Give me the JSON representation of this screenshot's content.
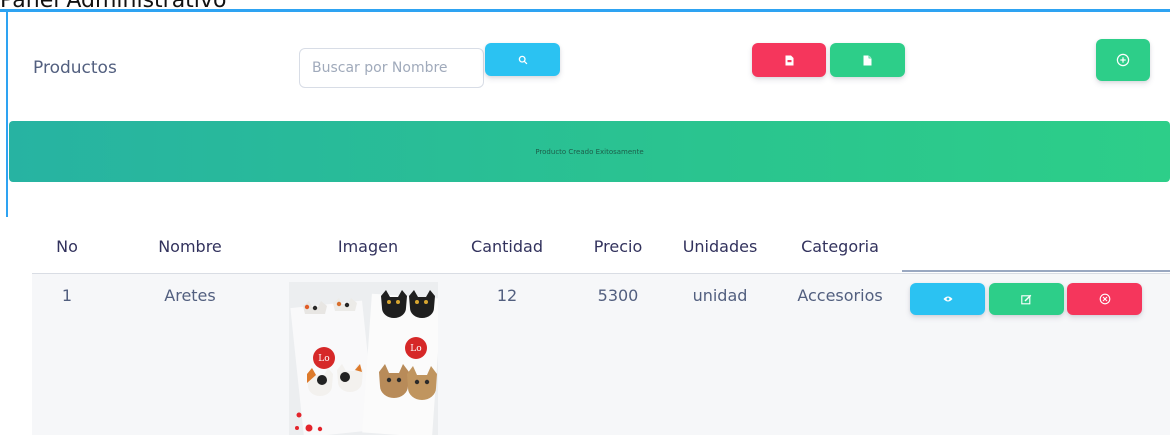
{
  "page": {
    "heading": "Panel Administrativo"
  },
  "header": {
    "section_title": "Productos",
    "search": {
      "placeholder": "Buscar por Nombre",
      "value": ""
    },
    "icons": {
      "search": "search-icon",
      "pdf": "pdf-file-icon",
      "excel": "excel-file-icon",
      "add": "add-circle-icon"
    }
  },
  "alert": {
    "message": "Producto Creado Exitosamente"
  },
  "table": {
    "headers": [
      "No",
      "Nombre",
      "Imagen",
      "Cantidad",
      "Precio",
      "Unidades",
      "Categoria"
    ],
    "rows": [
      {
        "no": "1",
        "nombre": "Aretes",
        "cantidad": "12",
        "precio": "5300",
        "unidades": "unidad",
        "categoria": "Accesorios",
        "image": "product-earrings-image"
      }
    ],
    "row_actions": [
      "view-icon",
      "edit-icon",
      "delete-icon"
    ]
  },
  "colors": {
    "accent_blue": "#2bc2f2",
    "danger_red": "#f5365c",
    "success_green": "#2dce89"
  }
}
